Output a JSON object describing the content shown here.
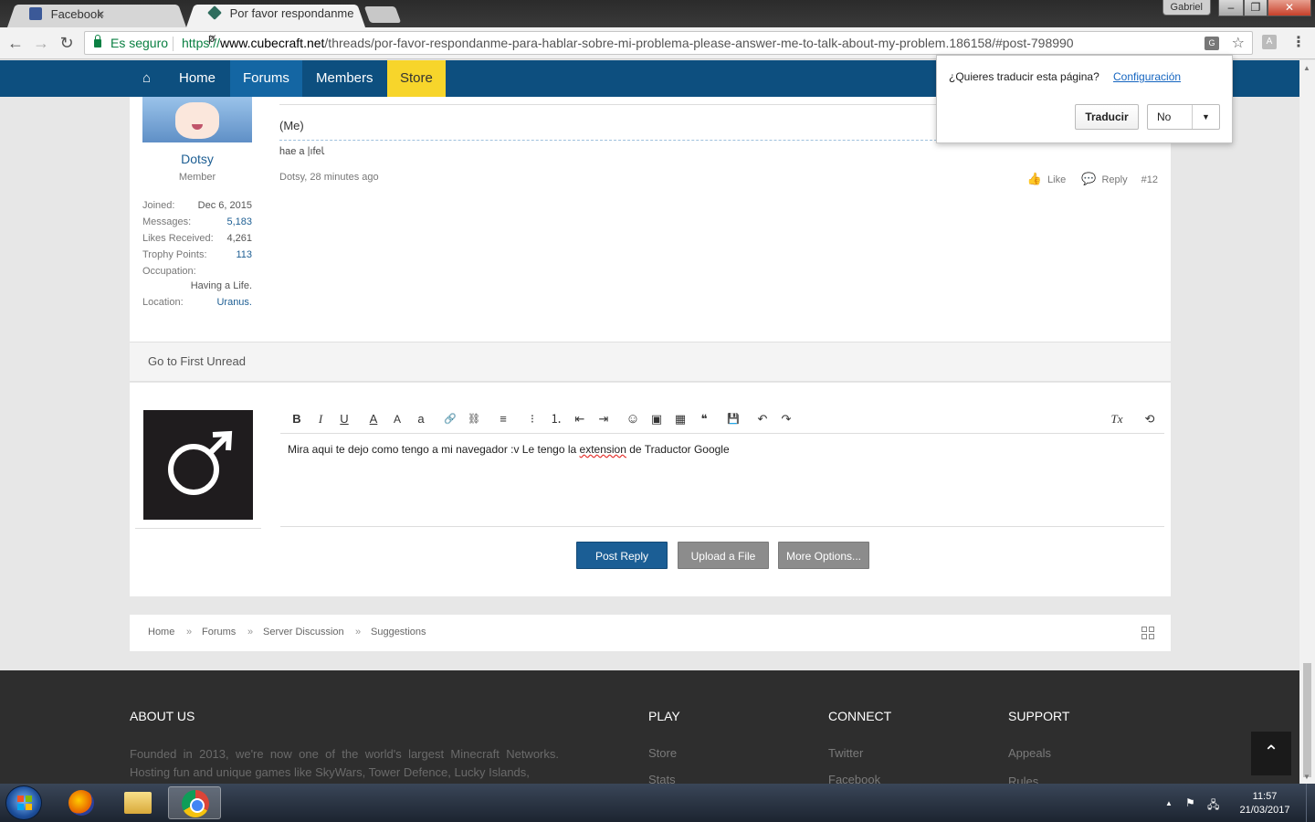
{
  "browser": {
    "tabs": [
      {
        "title": "Facebook",
        "active": false
      },
      {
        "title": "Por favor respondanme p",
        "active": true
      }
    ],
    "close_glyph": "×",
    "window_user": "Gabriel",
    "window_buttons": {
      "minimize": "–",
      "maximize": "❐",
      "close": "✕"
    },
    "nav": {
      "back": "←",
      "forward": "→",
      "reload": "↻"
    },
    "secure_label": "Es seguro",
    "url_scheme": "https://",
    "url_host": "www.cubecraft.net",
    "url_path": "/threads/por-favor-respondanme-para-hablar-sobre-mi-problema-please-answer-me-to-talk-about-my-problem.186158/#post-798990",
    "translate_icon_glyph": "G",
    "star_glyph": "☆",
    "menu_glyph": "⋮"
  },
  "translate_bubble": {
    "question": "¿Quieres traducir esta página?",
    "settings_link": "Configuración",
    "translate_button": "Traducir",
    "select_value": "No",
    "select_arrow": "▼"
  },
  "site_nav": {
    "home_icon": "⌂",
    "items": [
      "Home",
      "Forums",
      "Members",
      "Store"
    ],
    "active": "Forums",
    "highlight_color": "#f7d52b",
    "bar_color": "#0d4f7f"
  },
  "post": {
    "username": "Dotsy",
    "user_title": "Member",
    "stats": [
      {
        "label": "Joined:",
        "value": "Dec 6, 2015"
      },
      {
        "label": "Messages:",
        "value": "5,183"
      },
      {
        "label": "Likes Received:",
        "value": "4,261"
      },
      {
        "label": "Trophy Points:",
        "value": "113"
      },
      {
        "label": "Occupation:",
        "value": "Having a Life."
      },
      {
        "label": "Location:",
        "value": "Uranus."
      }
    ],
    "message": "(Me)",
    "signature_flipped": "ɿǝɟı| ɐ ǝɐɥ",
    "meta": "Dotsy, 28 minutes ago",
    "actions": {
      "like": "Like",
      "reply": "Reply",
      "number": "#12",
      "like_icon": "👍",
      "reply_icon": "💬"
    }
  },
  "go_to_first_unread": "Go to First Unread",
  "editor": {
    "toolbar": [
      {
        "name": "bold-button",
        "glyph": "B"
      },
      {
        "name": "italic-button",
        "glyph": "I"
      },
      {
        "name": "underline-button",
        "glyph": "U"
      },
      {
        "name": "text-color-button",
        "glyph": "A"
      },
      {
        "name": "font-size-button",
        "glyph": "A"
      },
      {
        "name": "font-family-button",
        "glyph": "a"
      },
      {
        "name": "link-button",
        "glyph": "🔗"
      },
      {
        "name": "unlink-button",
        "glyph": "⛓"
      },
      {
        "name": "align-button",
        "glyph": "≡"
      },
      {
        "name": "bullet-list-button",
        "glyph": "⁝"
      },
      {
        "name": "numbered-list-button",
        "glyph": "⒈"
      },
      {
        "name": "outdent-button",
        "glyph": "⇤"
      },
      {
        "name": "indent-button",
        "glyph": "⇥"
      },
      {
        "name": "smilie-button",
        "glyph": "☺"
      },
      {
        "name": "image-button",
        "glyph": "▣"
      },
      {
        "name": "media-button",
        "glyph": "▦"
      },
      {
        "name": "quote-button",
        "glyph": "❝"
      },
      {
        "name": "draft-button",
        "glyph": "💾"
      },
      {
        "name": "undo-button",
        "glyph": "↶"
      },
      {
        "name": "redo-button",
        "glyph": "↷"
      },
      {
        "name": "remove-format-button",
        "glyph": "Tx"
      },
      {
        "name": "toggle-bbcode-button",
        "glyph": "⟲"
      }
    ],
    "text_before": "Mira aqui te dejo como tengo a mi navegador :v Le tengo la ",
    "text_misspelled": "extension",
    "text_after": " de Traductor Google",
    "avatar_symbol": "♂",
    "buttons": {
      "post_reply": "Post Reply",
      "upload": "Upload a File",
      "more": "More Options..."
    }
  },
  "breadcrumb": {
    "items": [
      "Home",
      "Forums",
      "Server Discussion",
      "Suggestions"
    ],
    "separator": "»"
  },
  "footer": {
    "about_title": "ABOUT US",
    "about_text": "Founded in 2013, we're now one of the world's largest Minecraft Networks. Hosting fun and unique games like SkyWars, Tower Defence, Lucky Islands,",
    "play_title": "PLAY",
    "play_links": [
      "Store",
      "Stats"
    ],
    "connect_title": "CONNECT",
    "connect_links": [
      "Twitter",
      "Facebook"
    ],
    "support_title": "SUPPORT",
    "support_links": [
      "Appeals",
      "Rules"
    ],
    "to_top_glyph": "⌃"
  },
  "taskbar": {
    "time": "11:57",
    "date": "21/03/2017",
    "tray_up": "▲",
    "tray_flag": "⚑",
    "tray_network": "🖧"
  }
}
